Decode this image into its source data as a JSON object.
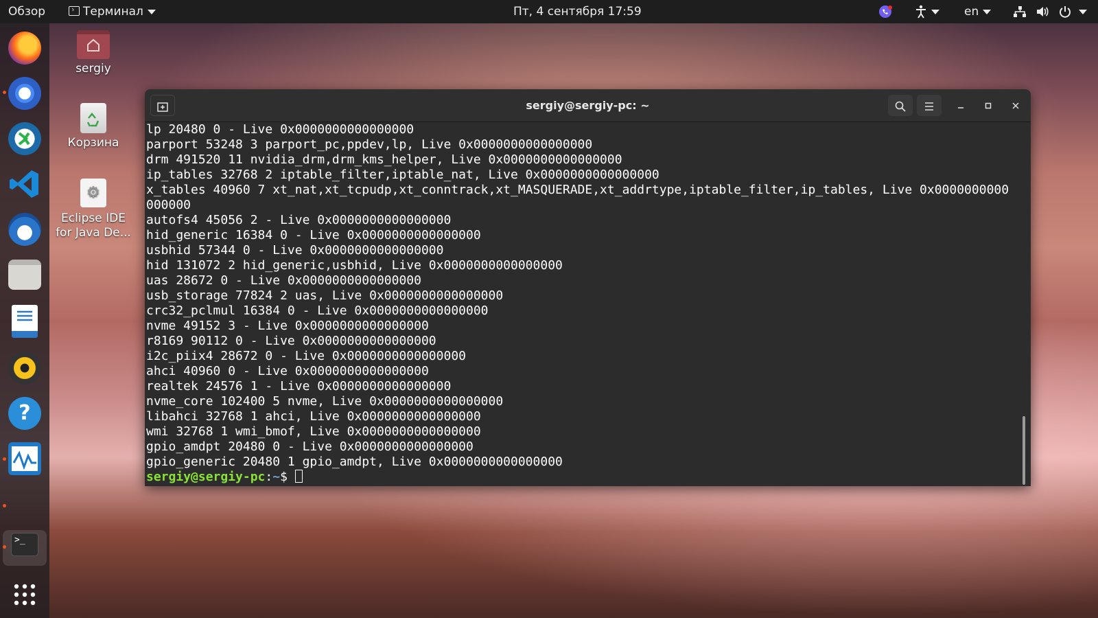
{
  "topbar": {
    "activities": "Обзор",
    "app_menu": "Терминал",
    "clock": "Пт, 4 сентября  17:59",
    "language": "en"
  },
  "dock": {
    "apps": [
      "firefox-icon",
      "chromium-icon",
      "remmina-icon",
      "vscode-icon",
      "thunderbird-icon",
      "files-icon",
      "writer-icon",
      "rhythmbox-icon",
      "help-icon",
      "monitor-icon",
      "terminal-icon",
      "app-grid-icon"
    ]
  },
  "desktop": {
    "home_label": "sergiy",
    "trash_label": "Корзина",
    "eclipse_label_1": "Eclipse IDE",
    "eclipse_label_2": "for Java De..."
  },
  "terminal": {
    "title": "sergiy@sergiy-pc: ~",
    "lines": [
      "lp 20480 0 - Live 0x0000000000000000",
      "parport 53248 3 parport_pc,ppdev,lp, Live 0x0000000000000000",
      "drm 491520 11 nvidia_drm,drm_kms_helper, Live 0x0000000000000000",
      "ip_tables 32768 2 iptable_filter,iptable_nat, Live 0x0000000000000000",
      "x_tables 40960 7 xt_nat,xt_tcpudp,xt_conntrack,xt_MASQUERADE,xt_addrtype,iptable_filter,ip_tables, Live 0x0000000000",
      "000000",
      "autofs4 45056 2 - Live 0x0000000000000000",
      "hid_generic 16384 0 - Live 0x0000000000000000",
      "usbhid 57344 0 - Live 0x0000000000000000",
      "hid 131072 2 hid_generic,usbhid, Live 0x0000000000000000",
      "uas 28672 0 - Live 0x0000000000000000",
      "usb_storage 77824 2 uas, Live 0x0000000000000000",
      "crc32_pclmul 16384 0 - Live 0x0000000000000000",
      "nvme 49152 3 - Live 0x0000000000000000",
      "r8169 90112 0 - Live 0x0000000000000000",
      "i2c_piix4 28672 0 - Live 0x0000000000000000",
      "ahci 40960 0 - Live 0x0000000000000000",
      "realtek 24576 1 - Live 0x0000000000000000",
      "nvme_core 102400 5 nvme, Live 0x0000000000000000",
      "libahci 32768 1 ahci, Live 0x0000000000000000",
      "wmi 32768 1 wmi_bmof, Live 0x0000000000000000",
      "gpio_amdpt 20480 0 - Live 0x0000000000000000",
      "gpio_generic 20480 1 gpio_amdpt, Live 0x0000000000000000"
    ],
    "prompt_user": "sergiy@sergiy-pc",
    "prompt_sep": ":",
    "prompt_path": "~",
    "prompt_symbol": "$ "
  }
}
